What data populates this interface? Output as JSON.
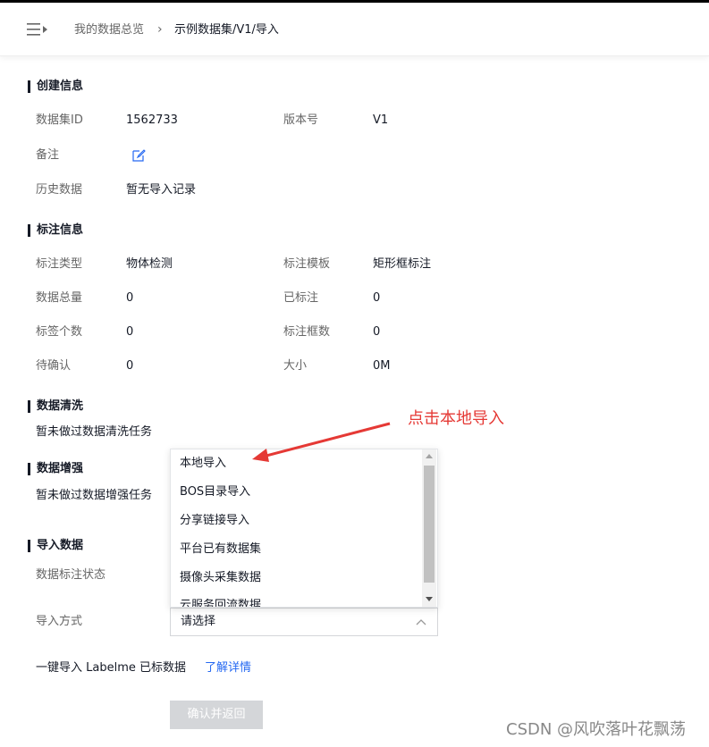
{
  "header": {
    "breadcrumb_parent": "我的数据总览",
    "breadcrumb_current": "示例数据集/V1/导入"
  },
  "create_info": {
    "title": "创建信息",
    "dataset_id_label": "数据集ID",
    "dataset_id_value": "1562733",
    "version_label": "版本号",
    "version_value": "V1",
    "remark_label": "备注",
    "history_label": "历史数据",
    "history_value": "暂无导入记录"
  },
  "annotation_info": {
    "title": "标注信息",
    "type_label": "标注类型",
    "type_value": "物体检测",
    "template_label": "标注模板",
    "template_value": "矩形框标注",
    "total_label": "数据总量",
    "total_value": "0",
    "labeled_label": "已标注",
    "labeled_value": "0",
    "tag_count_label": "标签个数",
    "tag_count_value": "0",
    "box_count_label": "标注框数",
    "box_count_value": "0",
    "pending_label": "待确认",
    "pending_value": "0",
    "size_label": "大小",
    "size_value": "0M"
  },
  "data_cleaning": {
    "title": "数据清洗",
    "text": "暂未做过数据清洗任务"
  },
  "data_augmentation": {
    "title": "数据增强",
    "text": "暂未做过数据增强任务"
  },
  "import_data": {
    "title": "导入数据",
    "status_label": "数据标注状态",
    "method_label": "导入方式",
    "select_placeholder": "请选择",
    "dropdown_options": [
      "本地导入",
      "BOS目录导入",
      "分享链接导入",
      "平台已有数据集",
      "摄像头采集数据",
      "云服务回流数据"
    ],
    "labelme_text": "一键导入 Labelme 已标数据",
    "learn_more": "了解详情",
    "confirm_button": "确认并返回"
  },
  "annotation_overlay": {
    "text": "点击本地导入",
    "color": "#e53935"
  },
  "watermark": "CSDN @风吹落叶花飘荡",
  "icons": [
    "menu-icon",
    "chevron-right-icon",
    "edit-icon",
    "chevron-up-icon"
  ],
  "colors": {
    "link": "#2468f2",
    "disabled_button": "#d4d6d9",
    "annotation": "#e53935"
  }
}
